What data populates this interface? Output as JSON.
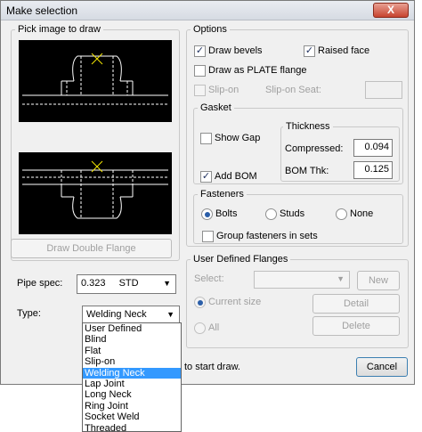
{
  "window": {
    "title": "Make selection",
    "close_label": "X"
  },
  "pick_image": {
    "label": "Pick image to draw",
    "draw_double_flange": "Draw Double Flange"
  },
  "pipe_spec": {
    "label": "Pipe spec:",
    "value": "0.323",
    "suffix": "STD"
  },
  "type": {
    "label": "Type:",
    "selected": "Welding Neck",
    "options": [
      "User Defined",
      "Blind",
      "Flat",
      "Slip-on",
      "Welding Neck",
      "Lap Joint",
      "Long Neck",
      "Ring Joint",
      "Socket Weld",
      "Threaded"
    ]
  },
  "options": {
    "label": "Options",
    "draw_bevels": {
      "label": "Draw bevels",
      "checked": true
    },
    "raised_face": {
      "label": "Raised face",
      "checked": true
    },
    "draw_as_plate": {
      "label": "Draw as PLATE flange",
      "checked": false
    },
    "slip_on": {
      "label": "Slip-on",
      "checked": false
    },
    "slip_on_seat": {
      "label": "Slip-on Seat:",
      "value": ""
    },
    "check_mark": "✓"
  },
  "gasket": {
    "label": "Gasket",
    "show_gap": {
      "label": "Show Gap",
      "checked": false
    },
    "add_bom": {
      "label": "Add BOM",
      "checked": true
    },
    "thickness": {
      "label": "Thickness",
      "compressed_label": "Compressed:",
      "compressed_value": "0.094",
      "bom_thk_label": "BOM Thk:",
      "bom_thk_value": "0.125"
    }
  },
  "fasteners": {
    "label": "Fasteners",
    "bolts": "Bolts",
    "studs": "Studs",
    "none": "None",
    "selected": "Bolts",
    "group_label": "Group fasteners in sets"
  },
  "user_defined": {
    "label": "User Defined Flanges",
    "select_label": "Select:",
    "new_button": "New",
    "current_size": "Current size",
    "all": "All",
    "detail_button": "Detail",
    "delete_button": "Delete"
  },
  "footer": {
    "status": "to start draw.",
    "cancel_button": "Cancel"
  },
  "colors": {
    "highlight": "#3399ff",
    "preview_bg": "#000000",
    "marker": "#f5e600"
  }
}
